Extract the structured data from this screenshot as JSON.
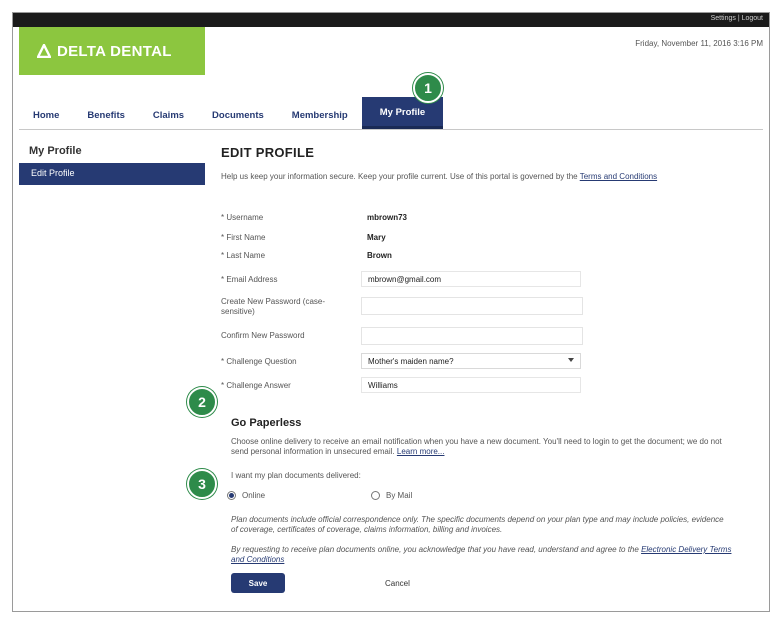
{
  "topbar": {
    "links": "Settings | Logout"
  },
  "logo": {
    "text": "DELTA DENTAL"
  },
  "datetime": "Friday, November 11, 2016 3:16 PM",
  "nav": {
    "items": [
      "Home",
      "Benefits",
      "Claims",
      "Documents",
      "Membership",
      "My Profile"
    ],
    "active_index": 5
  },
  "sidebar": {
    "title": "My Profile",
    "items": [
      "Edit Profile"
    ]
  },
  "page": {
    "title": "EDIT PROFILE",
    "intro": "Help us keep your information secure. Keep your profile current. Use of this portal is governed by the",
    "intro_link": "Terms and Conditions"
  },
  "fields": {
    "username_label": "* Username",
    "username_value": "mbrown73",
    "first_name_label": "* First Name",
    "first_name_value": "Mary",
    "last_name_label": "* Last Name",
    "last_name_value": "Brown",
    "email_label": "* Email Address",
    "email_value": "mbrown@gmail.com",
    "new_password_label": "Create New Password (case-sensitive)",
    "confirm_password_label": "Confirm New Password",
    "challenge_q_label": "* Challenge Question",
    "challenge_q_value": "Mother's maiden name?",
    "challenge_a_label": "* Challenge Answer",
    "challenge_a_value": "Williams"
  },
  "paperless": {
    "title": "Go Paperless",
    "description": "Choose online delivery to receive an email notification when you have a new document. You'll need to login to get the document; we do not send personal information in unsecured email.",
    "learn_more": "Learn more...",
    "question": "I want my plan documents delivered:",
    "options": [
      "Online",
      "By Mail"
    ],
    "selected": "Online",
    "note1": "Plan documents include official correspondence only. The specific documents depend on your plan type and may include policies, evidence of coverage, certificates of coverage, claims information, billing and invoices.",
    "note2": "By requesting to receive plan documents online, you acknowledge that you have read, understand and agree to the",
    "note2_link": "Electronic Delivery Terms and Conditions"
  },
  "buttons": {
    "save": "Save",
    "cancel": "Cancel"
  },
  "callouts": [
    "1",
    "2",
    "3"
  ],
  "colors": {
    "brand_green": "#8cc63f",
    "navy": "#263a73",
    "callout_green": "#2e8b4a"
  }
}
